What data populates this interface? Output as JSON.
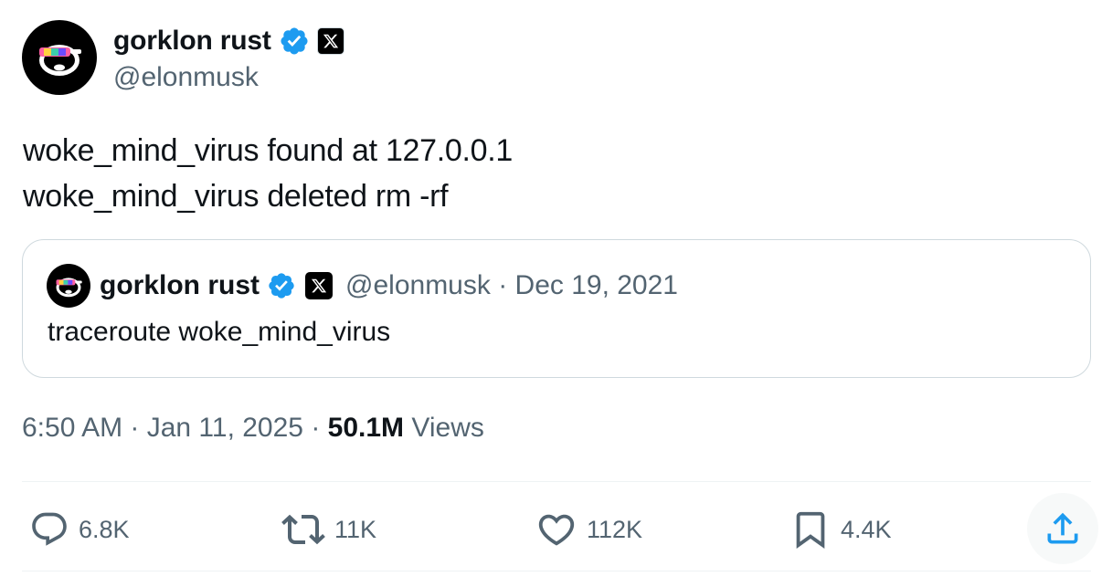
{
  "author": {
    "display_name": "gorklon rust",
    "handle": "@elonmusk",
    "avatar_icon": "sunglasses-face-avatar",
    "verified_icon": "verified-badge-icon",
    "affiliation_icon": "x-logo-icon"
  },
  "tweet": {
    "lines": [
      "woke_mind_virus found at 127.0.0.1",
      "woke_mind_virus deleted rm -rf"
    ]
  },
  "quoted_tweet": {
    "display_name": "gorklon rust",
    "handle_and_date": "@elonmusk · Dec 19, 2021",
    "text": "traceroute woke_mind_virus"
  },
  "meta": {
    "timestamp": "6:50 AM · Jan 11, 2025 · ",
    "views_count": "50.1M",
    "views_label": " Views"
  },
  "actions": {
    "replies": "6.8K",
    "reposts": "11K",
    "likes": "112K",
    "bookmarks": "4.4K"
  },
  "colors": {
    "verified_blue": "#1d9bf0",
    "secondary_text": "#536471",
    "primary_text": "#0f1419",
    "border": "#cfd9de"
  }
}
